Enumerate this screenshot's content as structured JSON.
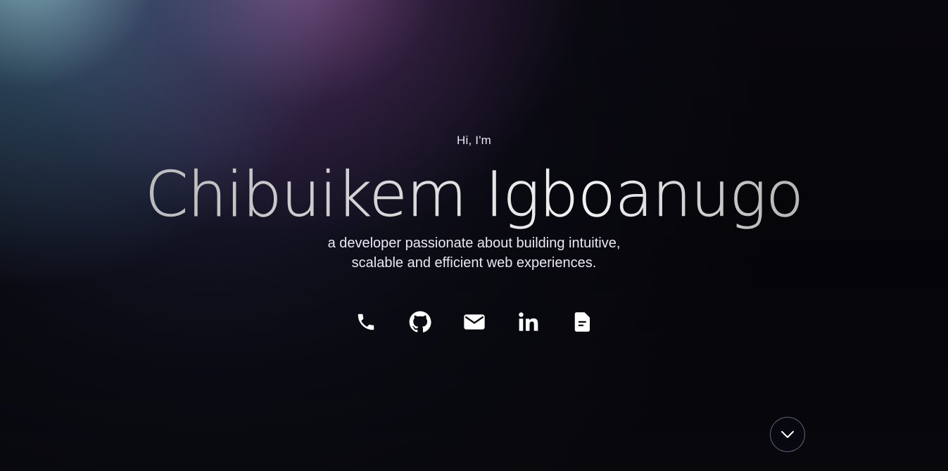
{
  "hero": {
    "greeting": "Hi, I'm",
    "name": "Chibuikem Igboanugo",
    "tagline_line1": "a developer passionate about building intuitive,",
    "tagline_line2": "scalable and efficient web experiences."
  },
  "socials": [
    {
      "icon": "phone-icon"
    },
    {
      "icon": "github-icon"
    },
    {
      "icon": "mail-icon"
    },
    {
      "icon": "linkedin-icon"
    },
    {
      "icon": "document-icon"
    }
  ],
  "scroll_button": {
    "icon": "chevron-down-icon"
  },
  "colors": {
    "background": "#050509",
    "text": "#ece8f3",
    "glow_teal": "#96c8d7",
    "glow_purple": "#965fa0"
  }
}
